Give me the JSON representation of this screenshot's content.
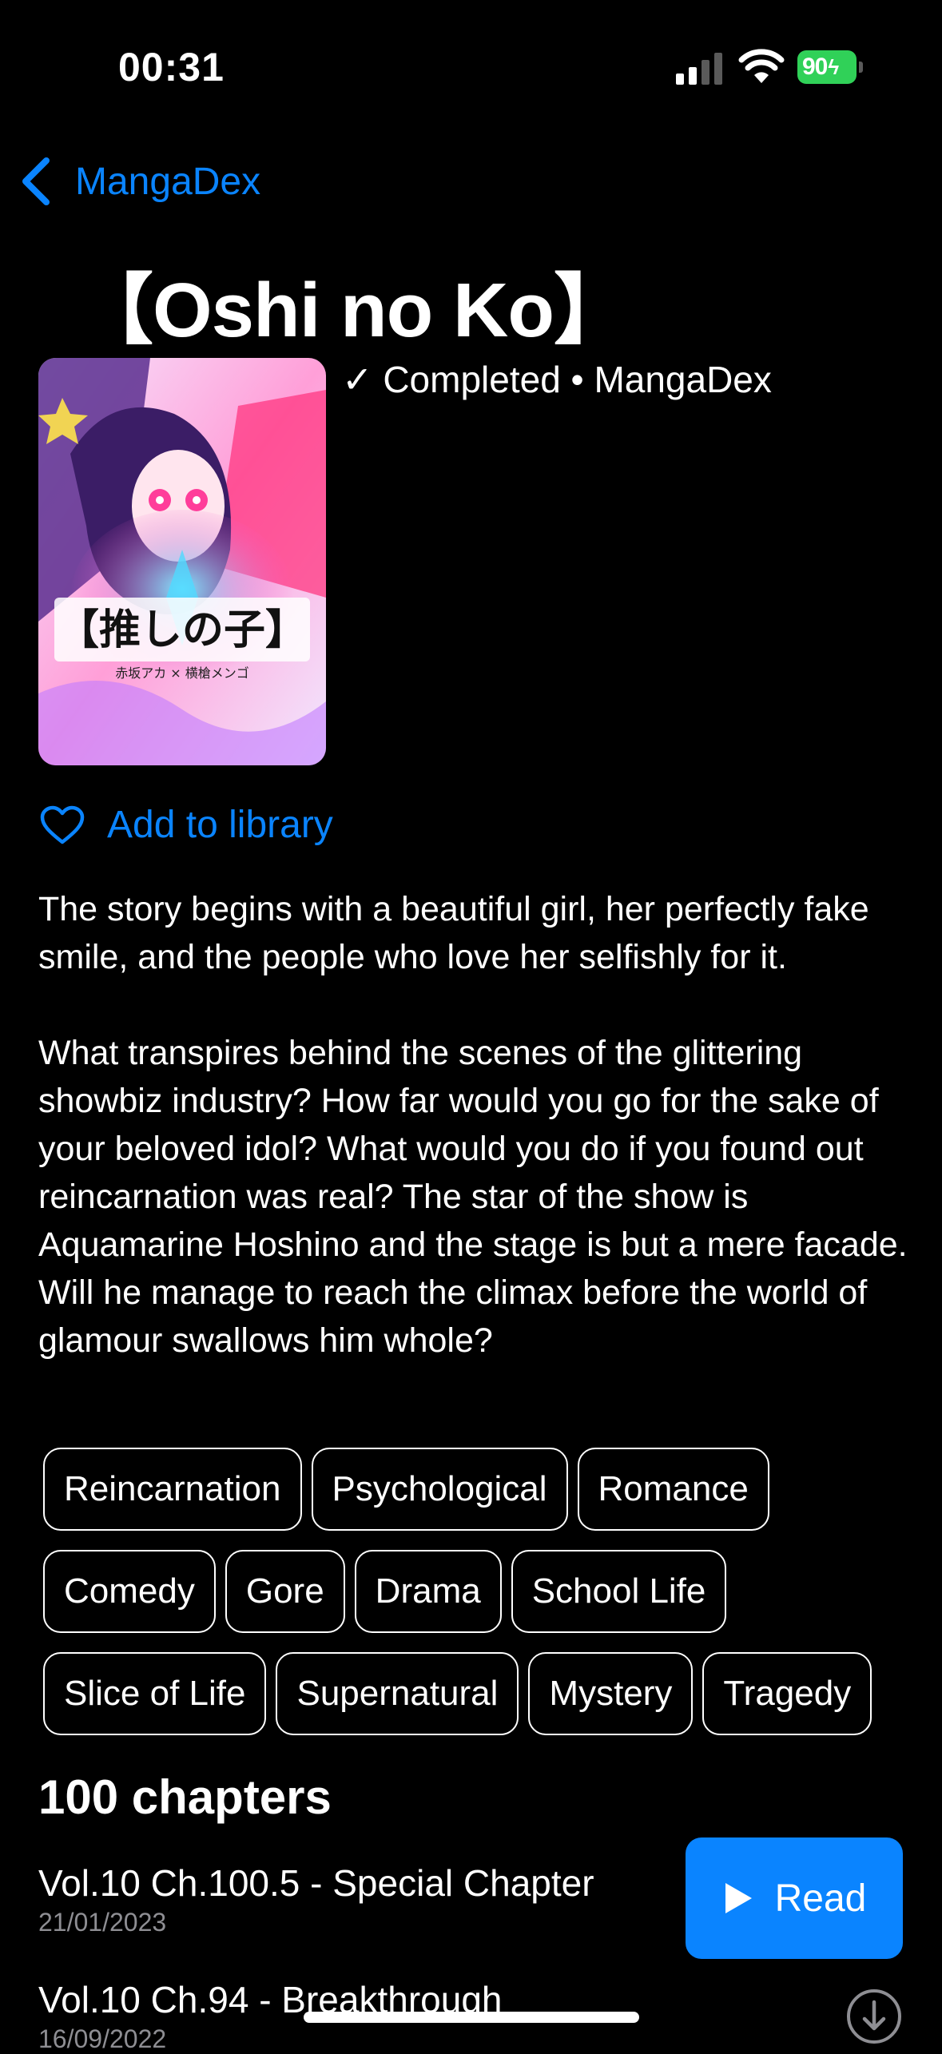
{
  "status_bar": {
    "time": "00:31",
    "battery_level": "90",
    "battery_color": "#30d158"
  },
  "nav": {
    "back_label": "MangaDex",
    "accent_color": "#0a84ff"
  },
  "manga": {
    "title": "【Oshi no Ko】",
    "status_line": "✓ Completed • MangaDex",
    "cover_icon": "manga-cover-image",
    "add_to_library_label": "Add to library",
    "description": [
      "The story begins with a beautiful girl, her perfectly fake smile, and the people who love her selfishly for it.",
      "What transpires behind the scenes of the glittering showbiz industry? How far would you go for the sake of your beloved idol? What would you do if you found out reincarnation was real? The star of the show is Aquamarine Hoshino and the stage is but a mere facade. Will he manage to reach the climax before the world of glamour swallows him whole?"
    ],
    "tags": [
      [
        "Reincarnation",
        "Psychological",
        "Romance"
      ],
      [
        "Comedy",
        "Gore",
        "Drama",
        "School Life"
      ],
      [
        "Slice of Life",
        "Supernatural",
        "Mystery",
        "Tragedy"
      ]
    ]
  },
  "chapters": {
    "heading": "100 chapters",
    "read_label": "Read",
    "items": [
      {
        "title": "Vol.10 Ch.100.5 - Special Chapter",
        "date": "21/01/2023"
      },
      {
        "title": "Vol.10 Ch.94 - Breakthrough",
        "date": "16/09/2022"
      }
    ]
  }
}
